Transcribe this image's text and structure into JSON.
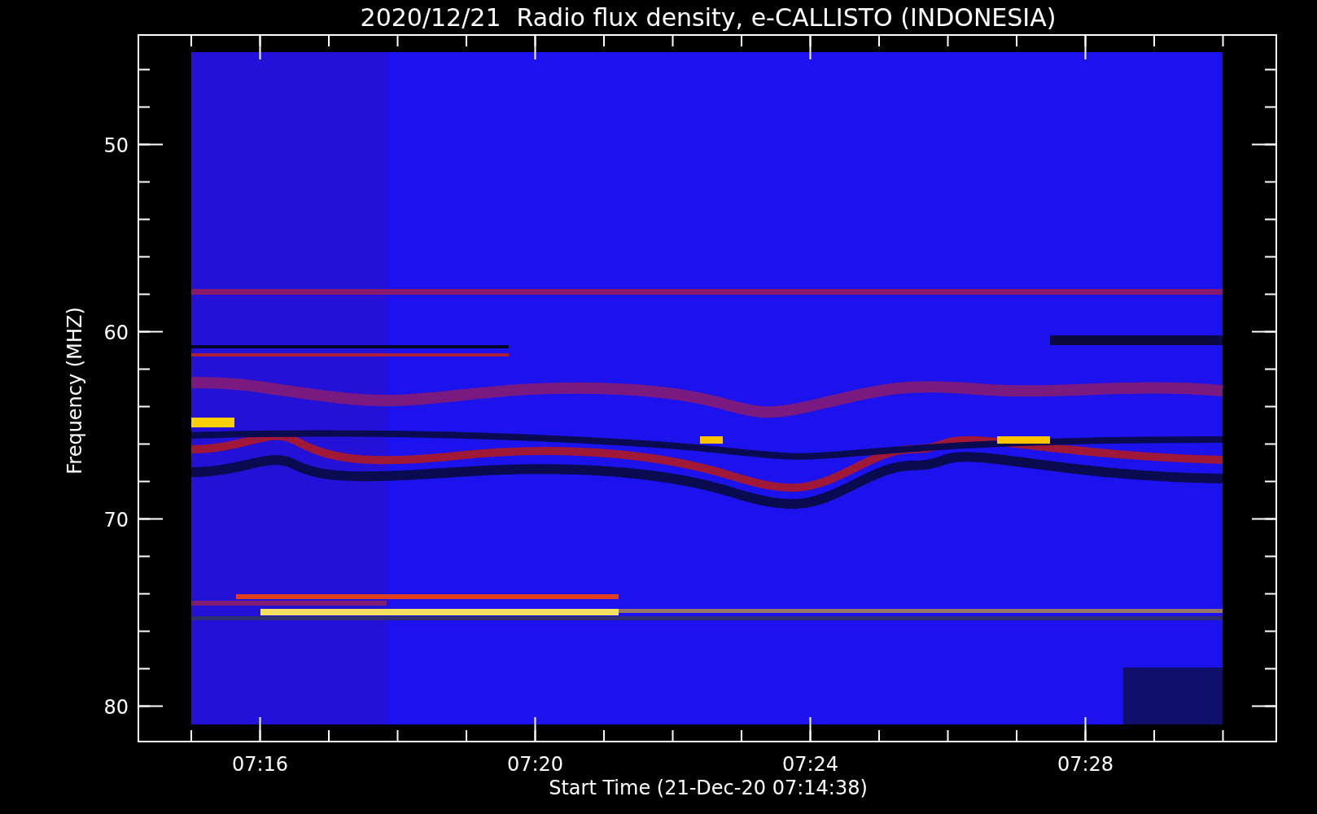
{
  "title": "2020/12/21  Radio flux density, e-CALLISTO (INDONESIA)",
  "y_axis": {
    "label": "Frequency (MHZ)",
    "ticks": [
      "50",
      "60",
      "70",
      "80"
    ]
  },
  "x_axis": {
    "label": "Start Time (21-Dec-20 07:14:38)",
    "ticks": [
      "07:16",
      "07:20",
      "07:24",
      "07:28"
    ]
  }
}
